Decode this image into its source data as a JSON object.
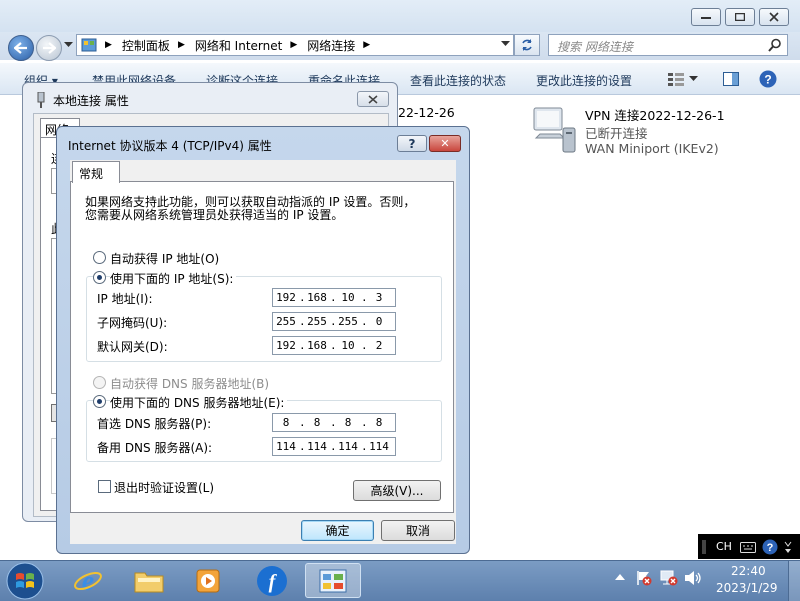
{
  "explorer": {
    "breadcrumb": [
      "控制面板",
      "网络和 Internet",
      "网络连接"
    ],
    "search_placeholder": "搜索 网络连接",
    "commands": [
      "组织 ▾",
      "禁用此网络设备",
      "诊断这个连接",
      "重命名此连接",
      "查看此连接的状态",
      "更改此连接的设置"
    ],
    "background_date": "22-12-26",
    "vpn_item": {
      "title": "VPN 连接2022-12-26-1",
      "status": "已断开连接",
      "device": "WAN Miniport (IKEv2)"
    }
  },
  "back_dialog": {
    "title": "本地连接 属性",
    "tab_fragment": "网络",
    "side_chars": [
      "连",
      "此"
    ]
  },
  "ipv4_dialog": {
    "title": "Internet 协议版本 4 (TCP/IPv4) 属性",
    "help_label": "?",
    "close_label": "✕",
    "tab_label": "常规",
    "description_line1": "如果网络支持此功能，则可以获取自动指派的 IP 设置。否则，",
    "description_line2": "您需要从网络系统管理员处获得适当的 IP 设置。",
    "ip_auto_label": "自动获得 IP 地址(O)",
    "ip_manual_label": "使用下面的 IP 地址(S):",
    "ip_mode": "manual",
    "ip_address": {
      "label": "IP 地址(I):",
      "octets": [
        "192",
        "168",
        "10",
        "3"
      ]
    },
    "subnet_mask": {
      "label": "子网掩码(U):",
      "octets": [
        "255",
        "255",
        "255",
        "0"
      ]
    },
    "gateway": {
      "label": "默认网关(D):",
      "octets": [
        "192",
        "168",
        "10",
        "2"
      ]
    },
    "dns_auto_label": "自动获得 DNS 服务器地址(B)",
    "dns_manual_label": "使用下面的 DNS 服务器地址(E):",
    "dns_mode": "manual",
    "preferred_dns": {
      "label": "首选 DNS 服务器(P):",
      "octets": [
        "8",
        "8",
        "8",
        "8"
      ]
    },
    "alternate_dns": {
      "label": "备用 DNS 服务器(A):",
      "octets": [
        "114",
        "114",
        "114",
        "114"
      ]
    },
    "validate_label": "退出时验证设置(L)",
    "validate_checked": false,
    "advanced_button": "高级(V)...",
    "ok_button": "确定",
    "cancel_button": "取消"
  },
  "taskbar": {
    "language": "CH",
    "time": "22:40",
    "date": "2023/1/29"
  },
  "colors": {
    "accent": "#1f3d6b",
    "taskbar": "#6a8cb8",
    "close_button": "#c9463d"
  }
}
